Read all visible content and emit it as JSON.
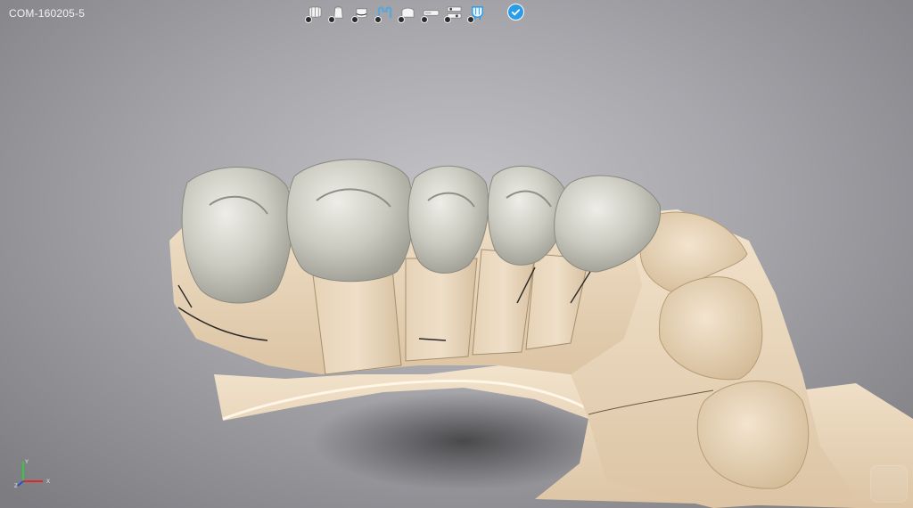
{
  "header": {
    "case_id": "COM-160205-5"
  },
  "toolbar": {
    "tools": [
      {
        "icon": "models-icon"
      },
      {
        "icon": "die-icon"
      },
      {
        "icon": "margin-icon"
      },
      {
        "icon": "insertion-icon"
      },
      {
        "icon": "tooth-design-icon"
      },
      {
        "icon": "connector-icon"
      },
      {
        "icon": "settings-stack-icon"
      },
      {
        "icon": "active-crown-icon"
      }
    ],
    "confirm": {
      "icon": "checkmark-icon"
    }
  },
  "axes": {
    "x_label": "X",
    "y_label": "Y",
    "z_label": "Z"
  },
  "colors": {
    "background_center": "#c4c4c8",
    "background_edge": "#7c7c81",
    "tooth_restoration": "#cfcfc6",
    "gum_model": "#ead8bf",
    "accent": "#2a9ce8"
  }
}
